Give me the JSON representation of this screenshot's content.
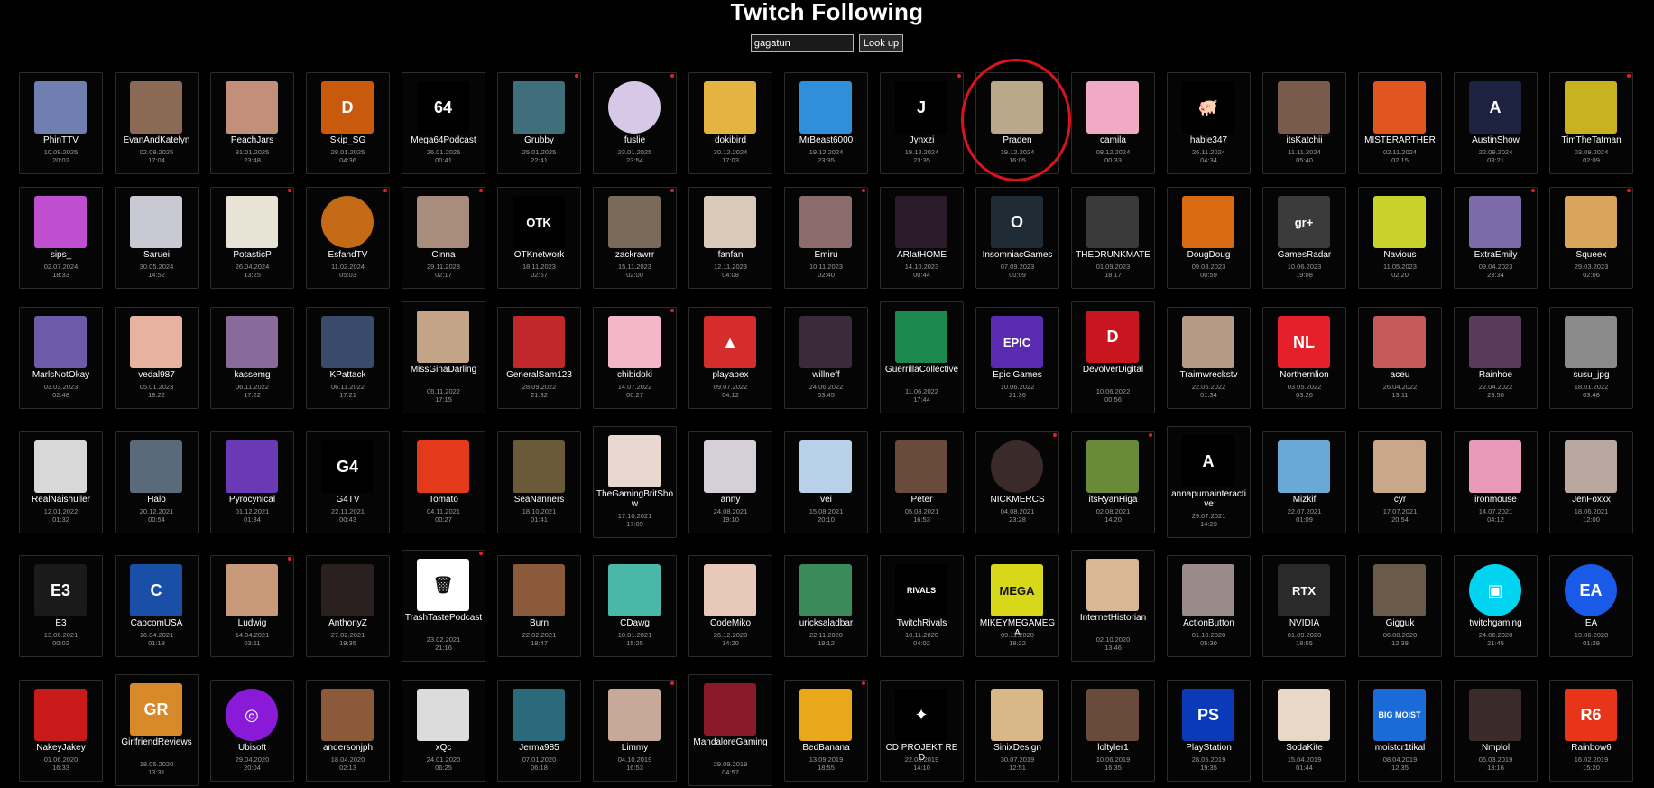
{
  "page": {
    "title": "Twitch Following"
  },
  "search": {
    "value": "gagatun",
    "button_label": "Look up"
  },
  "highlight_color": "#d9141c",
  "rows": [
    [
      {
        "name": "PhinTTV",
        "date": "10.09.2025",
        "time": "20:02",
        "live": false,
        "icon": "flag-portrait",
        "color": "#6f7fb0"
      },
      {
        "name": "EvanAndKatelyn",
        "date": "02.09.2025",
        "time": "17:04",
        "live": false,
        "icon": "couple-photo",
        "color": "#8a6a55"
      },
      {
        "name": "PeachJars",
        "date": "31.01.2025",
        "time": "23:48",
        "live": false,
        "icon": "catgirl-photo",
        "color": "#c28f7b"
      },
      {
        "name": "Skip_SG",
        "date": "28.01.2025",
        "time": "04:36",
        "live": false,
        "icon": "d-logo",
        "color": "#c95a0d",
        "label": "D"
      },
      {
        "name": "Mega64Podcast",
        "date": "26.01.2025",
        "time": "00:41",
        "live": false,
        "icon": "64-logo",
        "color": "#000000",
        "label": "64"
      },
      {
        "name": "Grubby",
        "date": "25.01.2025",
        "time": "22:41",
        "live": true,
        "icon": "man-photo",
        "color": "#3f6f7a"
      },
      {
        "name": "fuslie",
        "date": "23.01.2025",
        "time": "23:54",
        "live": true,
        "icon": "cartoon-girl",
        "color": "#d7c8e8",
        "round": true
      },
      {
        "name": "dokibird",
        "date": "30.12.2024",
        "time": "17:03",
        "live": false,
        "icon": "anime-bird",
        "color": "#e5b341"
      },
      {
        "name": "MrBeast6000",
        "date": "19.12.2024",
        "time": "23:35",
        "live": false,
        "icon": "beast-logo",
        "color": "#2f8fd8"
      },
      {
        "name": "Jynxzi",
        "date": "19.12.2024",
        "time": "23:35",
        "live": true,
        "icon": "j-logo",
        "color": "#000000",
        "label": "J"
      },
      {
        "name": "Praden",
        "date": "19.12.2024",
        "time": "16:05",
        "live": false,
        "icon": "pallet-photo",
        "color": "#b9a88a"
      },
      {
        "name": "camila",
        "date": "08.12.2024",
        "time": "00:33",
        "live": false,
        "icon": "anime-pink",
        "color": "#f1a9c4"
      },
      {
        "name": "habie347",
        "date": "26.11.2024",
        "time": "04:34",
        "live": false,
        "icon": "pig-icon",
        "color": "#000000",
        "label": "🐖"
      },
      {
        "name": "itsKatchii",
        "date": "11.11.2024",
        "time": "05:40",
        "live": false,
        "icon": "woman-photo",
        "color": "#7a5a4a"
      },
      {
        "name": "MISTERARTHER",
        "date": "02.11.2024",
        "time": "02:15",
        "live": false,
        "icon": "man-orange",
        "color": "#e2551f"
      },
      {
        "name": "AustinShow",
        "date": "22.09.2024",
        "time": "03:21",
        "live": false,
        "icon": "a-logo",
        "color": "#1c2240",
        "label": "A"
      },
      {
        "name": "TimTheTatman",
        "date": "03.09.2024",
        "time": "02:09",
        "live": true,
        "icon": "tatman-logo",
        "color": "#c8b21f"
      }
    ],
    [
      {
        "name": "sips_",
        "date": "02.07.2024",
        "time": "18:33",
        "live": false,
        "icon": "rainbow-face",
        "color": "#c04fd0"
      },
      {
        "name": "Saruei",
        "date": "30.05.2024",
        "time": "14:52",
        "live": false,
        "icon": "anime-white",
        "color": "#c9c9d4"
      },
      {
        "name": "PotasticP",
        "date": "26.04.2024",
        "time": "13:25",
        "live": true,
        "icon": "panda-girl",
        "color": "#e8e3d4"
      },
      {
        "name": "EsfandTV",
        "date": "11.02.2024",
        "time": "05:03",
        "live": true,
        "icon": "ring-portrait",
        "color": "#c46a16",
        "round": true
      },
      {
        "name": "Cinna",
        "date": "29.11.2023",
        "time": "02:17",
        "live": true,
        "icon": "woman-photo",
        "color": "#a88d7c"
      },
      {
        "name": "OTKnetwork",
        "date": "18.11.2023",
        "time": "02:57",
        "live": false,
        "icon": "otk-logo",
        "color": "#000000",
        "label": "OTK"
      },
      {
        "name": "zackrawrr",
        "date": "15.11.2023",
        "time": "02:00",
        "live": true,
        "icon": "man-glasses",
        "color": "#7a6a5a"
      },
      {
        "name": "fanfan",
        "date": "12.11.2023",
        "time": "04:08",
        "live": false,
        "icon": "figure-photo",
        "color": "#d9c9b8"
      },
      {
        "name": "Emiru",
        "date": "10.11.2023",
        "time": "02:40",
        "live": true,
        "icon": "woman-photo",
        "color": "#8b6b6b"
      },
      {
        "name": "ARIatHOME",
        "date": "14.10.2023",
        "time": "00:44",
        "live": false,
        "icon": "studio-photo",
        "color": "#2a1a2a"
      },
      {
        "name": "InsomniacGames",
        "date": "07.09.2023",
        "time": "00:09",
        "live": false,
        "icon": "crescent-logo",
        "color": "#1f2b35",
        "label": "O"
      },
      {
        "name": "THEDRUNKMATE",
        "date": "01.09.2023",
        "time": "18:17",
        "live": false,
        "icon": "bw-photo",
        "color": "#3a3a3a"
      },
      {
        "name": "DougDoug",
        "date": "09.08.2023",
        "time": "00:59",
        "live": false,
        "icon": "pepper-face",
        "color": "#d96a12"
      },
      {
        "name": "GamesRadar",
        "date": "10.06.2023",
        "time": "19:08",
        "live": false,
        "icon": "gr-logo",
        "color": "#3b3b3b",
        "label": "gr+"
      },
      {
        "name": "Navious",
        "date": "11.05.2023",
        "time": "02:20",
        "live": false,
        "icon": "man-glasses",
        "color": "#c8d22a"
      },
      {
        "name": "ExtraEmily",
        "date": "09.04.2023",
        "time": "23:34",
        "live": true,
        "icon": "woman-photo",
        "color": "#7d6aa8"
      },
      {
        "name": "Squeex",
        "date": "29.03.2023",
        "time": "02:06",
        "live": true,
        "icon": "cartoon-face",
        "color": "#d9a55a"
      }
    ],
    [
      {
        "name": "MarlsNotOkay",
        "date": "03.03.2023",
        "time": "02:48",
        "live": false,
        "icon": "anime-purple",
        "color": "#6d5aa8"
      },
      {
        "name": "vedal987",
        "date": "05.01.2023",
        "time": "18:22",
        "live": false,
        "icon": "anime-girl",
        "color": "#e8b2a0"
      },
      {
        "name": "kassemg",
        "date": "06.11.2022",
        "time": "17:22",
        "live": false,
        "icon": "man-photo",
        "color": "#8a6a9a"
      },
      {
        "name": "KPattack",
        "date": "06.11.2022",
        "time": "17:21",
        "live": false,
        "icon": "person-photo",
        "color": "#3a4a6a"
      },
      {
        "name": "MissGinaDarling",
        "date": "06.11.2022",
        "time": "17:15",
        "live": false,
        "icon": "woman-photo",
        "color": "#c4a487"
      },
      {
        "name": "GeneralSam123",
        "date": "28.09.2022",
        "time": "21:32",
        "live": false,
        "icon": "red-face",
        "color": "#c0282a"
      },
      {
        "name": "chibidoki",
        "date": "14.07.2022",
        "time": "00:27",
        "live": true,
        "icon": "anime-pink",
        "color": "#f4b7c9"
      },
      {
        "name": "playapex",
        "date": "09.07.2022",
        "time": "04:12",
        "live": false,
        "icon": "apex-logo",
        "color": "#d52c2c",
        "label": "▲"
      },
      {
        "name": "willneff",
        "date": "24.06.2022",
        "time": "03:45",
        "live": false,
        "icon": "dark-portrait",
        "color": "#3a2a3a"
      },
      {
        "name": "GuerrillaCollective",
        "date": "11.06.2022",
        "time": "17:44",
        "live": false,
        "icon": "gc-logo",
        "color": "#1c8a4f"
      },
      {
        "name": "Epic Games",
        "date": "10.06.2022",
        "time": "21:36",
        "live": false,
        "icon": "epic-logo",
        "color": "#5a2ab0",
        "label": "EPIC"
      },
      {
        "name": "DevolverDigital",
        "date": "10.06.2022",
        "time": "00:56",
        "live": false,
        "icon": "d-logo",
        "color": "#c8151f",
        "label": "D"
      },
      {
        "name": "Traimwreckstv",
        "date": "22.05.2022",
        "time": "01:34",
        "live": false,
        "icon": "face-photo",
        "color": "#b59a86"
      },
      {
        "name": "Northernlion",
        "date": "03.05.2022",
        "time": "03:26",
        "live": false,
        "icon": "nl-logo",
        "color": "#e5202a",
        "label": "NL"
      },
      {
        "name": "aceu",
        "date": "26.04.2022",
        "time": "13:11",
        "live": false,
        "icon": "man-photo",
        "color": "#c45a5a"
      },
      {
        "name": "Rainhoe",
        "date": "22.04.2022",
        "time": "23:50",
        "live": false,
        "icon": "anime-purple",
        "color": "#5a3a5a"
      },
      {
        "name": "susu_jpg",
        "date": "18.01.2022",
        "time": "03:48",
        "live": false,
        "icon": "woman-photo",
        "color": "#8a8a8a"
      }
    ],
    [
      {
        "name": "RealNaishuller",
        "date": "12.01.2022",
        "time": "01:32",
        "live": false,
        "icon": "bw-photo",
        "color": "#d8d8d8"
      },
      {
        "name": "Halo",
        "date": "20.12.2021",
        "time": "00:54",
        "live": false,
        "icon": "halo-helmet",
        "color": "#5a6a7a"
      },
      {
        "name": "Pyrocynical",
        "date": "01.12.2021",
        "time": "01:34",
        "live": false,
        "icon": "purple-ghost",
        "color": "#6a3ab5"
      },
      {
        "name": "G4TV",
        "date": "22.11.2021",
        "time": "00:43",
        "live": false,
        "icon": "g4-logo",
        "color": "#000000",
        "label": "G4"
      },
      {
        "name": "Tomato",
        "date": "04.11.2021",
        "time": "00:27",
        "live": false,
        "icon": "tomato-face",
        "color": "#e23a1a"
      },
      {
        "name": "SeaNanners",
        "date": "18.10.2021",
        "time": "01:41",
        "live": false,
        "icon": "cat-photo",
        "color": "#6a5a3a"
      },
      {
        "name": "TheGamingBritShow",
        "date": "17.10.2021",
        "time": "17:09",
        "live": false,
        "icon": "anime-girl",
        "color": "#e8d8d0"
      },
      {
        "name": "anny",
        "date": "24.08.2021",
        "time": "19:10",
        "live": false,
        "icon": "anime-white",
        "color": "#d4cfd8"
      },
      {
        "name": "vei",
        "date": "15.08.2021",
        "time": "20:10",
        "live": false,
        "icon": "anime-girl",
        "color": "#b8d0e8"
      },
      {
        "name": "Peter",
        "date": "05.08.2021",
        "time": "16:53",
        "live": false,
        "icon": "man-photo",
        "color": "#6a4a3a"
      },
      {
        "name": "NICKMERCS",
        "date": "04.08.2021",
        "time": "23:28",
        "live": true,
        "icon": "man-photo",
        "color": "#3a2a2a",
        "round": true
      },
      {
        "name": "itsRyanHiga",
        "date": "02.08.2021",
        "time": "14:20",
        "live": true,
        "icon": "deer-photo",
        "color": "#6a8a3a"
      },
      {
        "name": "annapurnainteractive",
        "date": "29.07.2021",
        "time": "14:23",
        "live": false,
        "icon": "a-logo",
        "color": "#000000",
        "label": "A"
      },
      {
        "name": "Mizkif",
        "date": "22.07.2021",
        "time": "01:09",
        "live": false,
        "icon": "boy-photo",
        "color": "#6aa8d8"
      },
      {
        "name": "cyr",
        "date": "17.07.2021",
        "time": "20:54",
        "live": false,
        "icon": "man-photo",
        "color": "#c9a88a"
      },
      {
        "name": "ironmouse",
        "date": "14.07.2021",
        "time": "04:12",
        "live": false,
        "icon": "anime-pink",
        "color": "#e89ab8"
      },
      {
        "name": "JenFoxxx",
        "date": "18.06.2021",
        "time": "12:00",
        "live": false,
        "icon": "woman-photo",
        "color": "#b8a8a0"
      }
    ],
    [
      {
        "name": "E3",
        "date": "13.06.2021",
        "time": "00:02",
        "live": false,
        "icon": "e3-logo",
        "color": "#1a1a1a",
        "label": "E3"
      },
      {
        "name": "CapcomUSA",
        "date": "16.04.2021",
        "time": "01:18",
        "live": false,
        "icon": "capcom-logo",
        "color": "#1a4fa8",
        "label": "C"
      },
      {
        "name": "Ludwig",
        "date": "14.04.2021",
        "time": "03:11",
        "live": true,
        "icon": "man-photo",
        "color": "#c89a7a"
      },
      {
        "name": "AnthonyZ",
        "date": "27.02.2021",
        "time": "19:35",
        "live": false,
        "icon": "dark-portrait",
        "color": "#2a2020"
      },
      {
        "name": "TrashTastePodcast",
        "date": "23.02.2021",
        "time": "21:16",
        "live": true,
        "icon": "trash-logo",
        "color": "#ffffff",
        "label": "🗑"
      },
      {
        "name": "Burn",
        "date": "22.02.2021",
        "time": "18:47",
        "live": false,
        "icon": "cartoon-man",
        "color": "#8a5a3a"
      },
      {
        "name": "CDawg",
        "date": "10.01.2021",
        "time": "15:25",
        "live": false,
        "icon": "anime-girl",
        "color": "#4ab8a8"
      },
      {
        "name": "CodeMiko",
        "date": "26.12.2020",
        "time": "14:20",
        "live": false,
        "icon": "3d-girl",
        "color": "#e8c8b8"
      },
      {
        "name": "uricksaladbar",
        "date": "22.11.2020",
        "time": "19:12",
        "live": false,
        "icon": "green-logo",
        "color": "#3a8a5a"
      },
      {
        "name": "TwitchRivals",
        "date": "10.11.2020",
        "time": "04:02",
        "live": false,
        "icon": "rivals-logo",
        "color": "#000000",
        "label": "RIVALS"
      },
      {
        "name": "MIKEYMEGAMEGA",
        "date": "09.11.2020",
        "time": "18:22",
        "live": false,
        "icon": "mikey-logo",
        "color": "#d8d81a",
        "label": "MEGA"
      },
      {
        "name": "InternetHistorian",
        "date": "02.10.2020",
        "time": "13:46",
        "live": false,
        "icon": "face-illustration",
        "color": "#d8b896"
      },
      {
        "name": "ActionButton",
        "date": "01.10.2020",
        "time": "05:30",
        "live": false,
        "icon": "person-photo",
        "color": "#9a8a8a"
      },
      {
        "name": "NVIDIA",
        "date": "01.09.2020",
        "time": "18:55",
        "live": false,
        "icon": "nvidia-logo",
        "color": "#2a2a2a",
        "label": "RTX"
      },
      {
        "name": "Gigguk",
        "date": "06.08.2020",
        "time": "12:38",
        "live": false,
        "icon": "man-photo",
        "color": "#6a5a4a"
      },
      {
        "name": "twitchgaming",
        "date": "24.06.2020",
        "time": "21:45",
        "live": false,
        "icon": "twitch-logo",
        "color": "#00d4f0",
        "round": true,
        "label": "▣"
      },
      {
        "name": "EA",
        "date": "19.06.2020",
        "time": "01:29",
        "live": false,
        "icon": "ea-logo",
        "color": "#1a5ae8",
        "round": true,
        "label": "EA"
      }
    ],
    [
      {
        "name": "NakeyJakey",
        "date": "01.06.2020",
        "time": "16:33",
        "live": false,
        "icon": "red-portrait",
        "color": "#c81a1a"
      },
      {
        "name": "GirlfriendReviews",
        "date": "18.05.2020",
        "time": "13:31",
        "live": false,
        "icon": "gr-logo",
        "color": "#d88a2a",
        "label": "GR"
      },
      {
        "name": "Ubisoft",
        "date": "29.04.2020",
        "time": "20:04",
        "live": false,
        "icon": "ubisoft-logo",
        "color": "#8a1ad8",
        "round": true,
        "label": "◎"
      },
      {
        "name": "andersonjph",
        "date": "18.04.2020",
        "time": "02:13",
        "live": false,
        "icon": "dragon-art",
        "color": "#8a5a3a"
      },
      {
        "name": "xQc",
        "date": "24.01.2020",
        "time": "06:25",
        "live": false,
        "icon": "gorilla-icon",
        "color": "#dcdcdc"
      },
      {
        "name": "Jerma985",
        "date": "07.01.2020",
        "time": "06:18",
        "live": false,
        "icon": "shark-art",
        "color": "#2a6a7a"
      },
      {
        "name": "Limmy",
        "date": "04.10.2019",
        "time": "16:53",
        "live": true,
        "icon": "face-photo",
        "color": "#c8a898"
      },
      {
        "name": "MandaloreGaming",
        "date": "29.09.2019",
        "time": "04:57",
        "live": false,
        "icon": "knight-art",
        "color": "#8a1a2a"
      },
      {
        "name": "BedBanana",
        "date": "13.09.2019",
        "time": "18:55",
        "live": true,
        "icon": "cat-art",
        "color": "#e8a81a"
      },
      {
        "name": "CD PROJEKT RED",
        "date": "22.08.2019",
        "time": "14:10",
        "live": false,
        "icon": "cdpr-logo",
        "color": "#000000",
        "label": "✦"
      },
      {
        "name": "SinixDesign",
        "date": "30.07.2019",
        "time": "12:51",
        "live": false,
        "icon": "anime-girl",
        "color": "#d8b888"
      },
      {
        "name": "loltyler1",
        "date": "10.06.2019",
        "time": "16:35",
        "live": false,
        "icon": "warrior-art",
        "color": "#6a4a3a"
      },
      {
        "name": "PlayStation",
        "date": "28.05.2019",
        "time": "19:35",
        "live": false,
        "icon": "ps-logo",
        "color": "#0a3ab8",
        "label": "PS"
      },
      {
        "name": "SodaKite",
        "date": "15.04.2019",
        "time": "01:44",
        "live": false,
        "icon": "anime-girl",
        "color": "#e8d8c8"
      },
      {
        "name": "moistcr1tikal",
        "date": "08.04.2019",
        "time": "12:35",
        "live": false,
        "icon": "moist-logo",
        "color": "#1a6ad8",
        "label": "BIG MOIST"
      },
      {
        "name": "Nmplol",
        "date": "06.03.2019",
        "time": "13:16",
        "live": false,
        "icon": "laughing-photo",
        "color": "#3a2a2a"
      },
      {
        "name": "Rainbow6",
        "date": "16.02.2019",
        "time": "15:20",
        "live": false,
        "icon": "r6-logo",
        "color": "#e8351a",
        "label": "R6"
      }
    ]
  ]
}
